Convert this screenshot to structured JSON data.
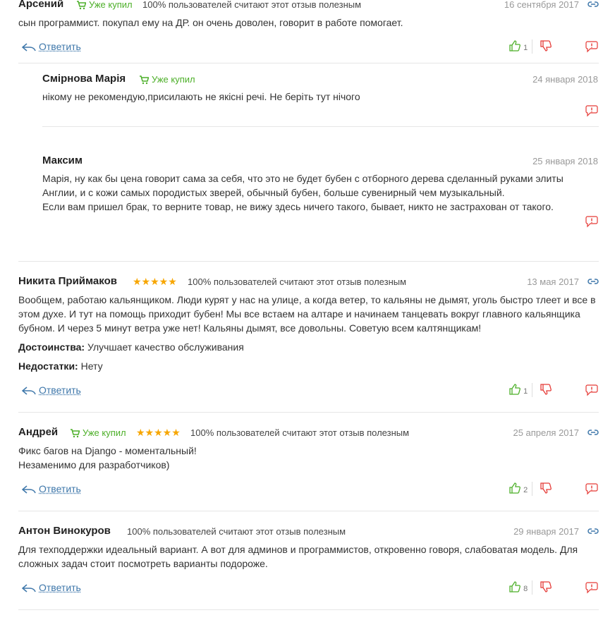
{
  "labels": {
    "buyer": "Уже купил",
    "reply": "Ответить",
    "advantages": "Достоинства:",
    "disadvantages": "Недостатки:"
  },
  "colors": {
    "green": "#4caf28",
    "red": "#e53935",
    "link": "#3e77aa",
    "star": "#f7a600",
    "date": "#999999"
  },
  "reviews": [
    {
      "author": "Арсений",
      "buyer": true,
      "useful": "100% пользователей считают этот отзыв полезным",
      "date": "16 сентября 2017",
      "text": "сын программист. покупал ему на ДР. он очень доволен, говорит в работе помогает.",
      "likes": "1"
    },
    {
      "author": "Никита Приймаков",
      "rating": 5,
      "useful": "100% пользователей считают этот отзыв полезным",
      "date": "13 мая 2017",
      "text": "Вообщем, работаю кальянщиком. Люди курят у нас на улице, а когда ветер, то кальяны не дымят, уголь быстро тлеет и все в этом духе. И тут на помощь приходит бубен! Мы все встаем на алтаре и начинаем танцевать вокруг главного кальянщика бубном. И через 5 минут ветра уже нет! Кальяны дымят, все довольны. Советую всем калтянщикам!",
      "advantages": "Улучшает качество обслуживания",
      "disadvantages": "Нету",
      "likes": "1"
    },
    {
      "author": "Андрей",
      "buyer": true,
      "rating": 5,
      "useful": "100% пользователей считают этот отзыв полезным",
      "date": "25 апреля 2017",
      "text_line1": "Фикс багов на Django - моментальный!",
      "text_line2": "Незаменимо для разработчиков)",
      "likes": "2"
    },
    {
      "author": "Антон Винокуров",
      "useful": "100% пользователей считают этот отзыв полезным",
      "date": "29 января 2017",
      "text": "Для техподдержки идеальный вариант. А вот для админов и программистов, откровенно говоря, слабоватая модель. Для сложных задач стоит посмотреть варианты подороже.",
      "likes": "8"
    }
  ],
  "replies": [
    {
      "author": "Смірнова Марія",
      "buyer": true,
      "date": "24 января 2018",
      "text": "нікому не рекомендую,присилають не якісні речі. Не беріть тут нічого"
    },
    {
      "author": "Максим",
      "date": "25 января 2018",
      "text_line1": "Марія, ну как бы цена говорит сама за себя, что это не будет бубен с отборного дерева сделанный руками элиты",
      "text_line2": "Англии, и с кожи самых породистых зверей, обычный бубен, больше сувенирный чем музыкальный.",
      "text_line3": "Если вам пришел брак, то верните товар, не вижу здесь ничего такого, бывает, никто не застрахован от такого."
    }
  ]
}
